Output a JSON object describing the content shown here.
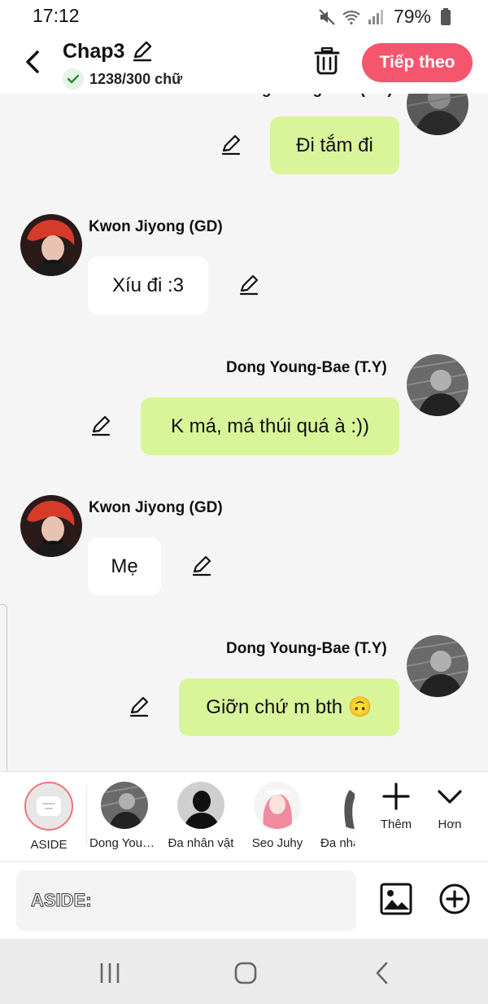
{
  "status_bar": {
    "time": "17:12",
    "battery": "79%",
    "icons": [
      "mute-icon",
      "wifi-icon",
      "signal-icon",
      "battery-icon"
    ]
  },
  "header": {
    "title": "Chap3",
    "word_count": "1238/300 chữ",
    "next_label": "Tiếp theo",
    "accent_color": "#f5566e"
  },
  "messages": [
    {
      "side": "me",
      "name": "",
      "text": "Đi tắm đi"
    },
    {
      "side": "other",
      "name": "Kwon Jiyong (GD)",
      "text": "Xíu đi :3"
    },
    {
      "side": "me",
      "name": "Dong Young-Bae (T.Y)",
      "text": "K má, má thúi quá à :))"
    },
    {
      "side": "other",
      "name": "Kwon Jiyong (GD)",
      "text": "Mẹ"
    },
    {
      "side": "me",
      "name": "Dong Young-Bae (T.Y)",
      "text": "Giỡn chứ m bth 🙃"
    }
  ],
  "colors": {
    "my_bubble": "#d9f59a",
    "other_bubble": "#ffffff",
    "chat_bg": "#f5f5f5"
  },
  "characters": {
    "aside_label": "ASIDE",
    "items": [
      {
        "label": "Dong Young-Bae (T.Y)"
      },
      {
        "label": "Đa nhân vật"
      },
      {
        "label": "Seo Juhy"
      },
      {
        "label": "Đa nhân vật"
      }
    ],
    "add_label": "Thêm",
    "more_label": "Hơn"
  },
  "input": {
    "placeholder": "ASIDE:"
  }
}
